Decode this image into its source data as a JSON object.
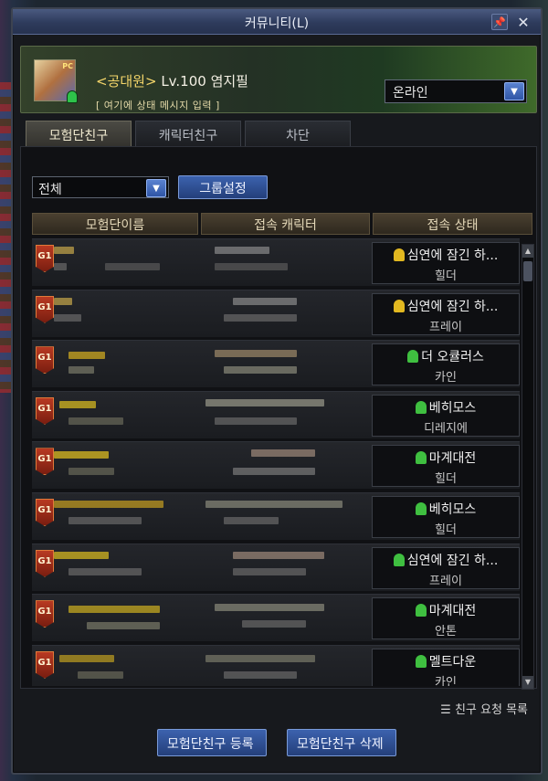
{
  "window": {
    "title": "커뮤니티(L)"
  },
  "profile": {
    "guild": "<공대원>",
    "name": "Lv.100 염지필",
    "status_message": "[ 여기에 상태 메시지 입력 ]",
    "presence": "온라인",
    "avatar_badge": "PC"
  },
  "tabs": [
    "모험단친구",
    "캐릭터친구",
    "차단"
  ],
  "filter": {
    "selected": "전체",
    "group_button": "그룹설정"
  },
  "table": {
    "headers": [
      "모험단이름",
      "접속 캐릭터",
      "접속 상태"
    ],
    "rows": [
      {
        "badge": "G1",
        "location": "심연에 잠긴 하...",
        "job": "힐더",
        "level_icon": "gold"
      },
      {
        "badge": "G1",
        "location": "심연에 잠긴 하...",
        "job": "프레이",
        "level_icon": "gold"
      },
      {
        "badge": "G1",
        "location": "더 오큘러스",
        "job": "카인",
        "level_icon": "green"
      },
      {
        "badge": "G1",
        "location": "베히모스",
        "job": "디레지에",
        "level_icon": "green"
      },
      {
        "badge": "G1",
        "location": "마계대전",
        "job": "힐더",
        "level_icon": "green"
      },
      {
        "badge": "G1",
        "location": "베히모스",
        "job": "힐더",
        "level_icon": "green"
      },
      {
        "badge": "G1",
        "location": "심연에 잠긴 하...",
        "job": "프레이",
        "level_icon": "green"
      },
      {
        "badge": "G1",
        "location": "마계대전",
        "job": "안톤",
        "level_icon": "green"
      },
      {
        "badge": "G1",
        "location": "멜트다운",
        "job": "카인",
        "level_icon": "green"
      }
    ]
  },
  "footer": {
    "request_list": "친구 요청 목록",
    "register_button": "모험단친구 등록",
    "delete_button": "모험단친구 삭제"
  },
  "colors": {
    "accent_blue": "#2f55a5",
    "header_gold": "#4a4030",
    "online_green": "#3fbf40",
    "level_gold": "#e2b820"
  }
}
